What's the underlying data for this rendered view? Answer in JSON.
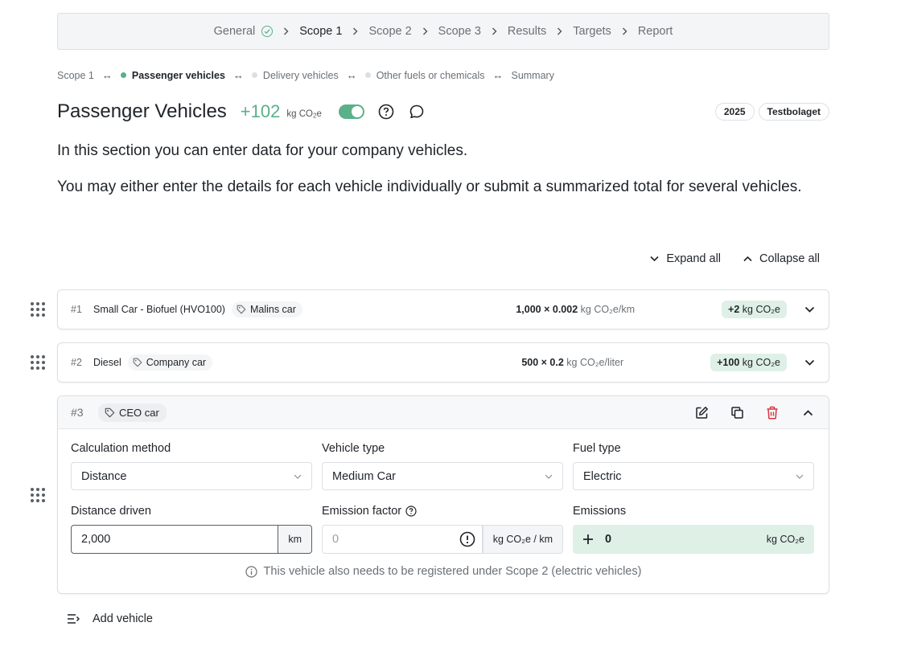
{
  "stepper": {
    "steps": [
      {
        "label": "General",
        "done": true
      },
      {
        "label": "Scope 1",
        "active": true
      },
      {
        "label": "Scope 2"
      },
      {
        "label": "Scope 3"
      },
      {
        "label": "Results"
      },
      {
        "label": "Targets"
      },
      {
        "label": "Report"
      }
    ]
  },
  "subnav": {
    "root": "Scope 1",
    "items": [
      "Passenger vehicles",
      "Delivery vehicles",
      "Other fuels or chemicals",
      "Summary"
    ]
  },
  "header": {
    "title": "Passenger Vehicles",
    "total": "+102",
    "total_unit_prefix": "kg CO",
    "total_unit_sub": "2",
    "total_unit_suffix": "e",
    "year_pill": "2025",
    "company_pill": "Testbolaget"
  },
  "intro": {
    "p1": "In this section you can enter data for your company vehicles.",
    "p2": "You may either enter the details for each vehicle individually or submit a summarized total for several vehicles."
  },
  "controls": {
    "expand_all": "Expand all",
    "collapse_all": "Collapse all"
  },
  "vehicles": [
    {
      "index": "#1",
      "name": "Small Car - Biofuel (HVO100)",
      "tag": "Malins car",
      "formula": "1,000 × 0.002",
      "formula_unit": "kg CO₂e/km",
      "emission": "+2",
      "emission_unit": "kg CO₂e"
    },
    {
      "index": "#2",
      "name": "Diesel",
      "tag": "Company car",
      "formula": "500 × 0.2",
      "formula_unit": "kg CO₂e/liter",
      "emission": "+100",
      "emission_unit": "kg CO₂e"
    }
  ],
  "vehicle3": {
    "index": "#3",
    "tag": "CEO car",
    "calculation_method": {
      "label": "Calculation method",
      "value": "Distance"
    },
    "vehicle_type": {
      "label": "Vehicle type",
      "value": "Medium Car"
    },
    "fuel_type": {
      "label": "Fuel type",
      "value": "Electric"
    },
    "distance": {
      "label": "Distance driven",
      "value": "2,000",
      "unit": "km"
    },
    "emission_factor": {
      "label": "Emission factor",
      "placeholder": "0",
      "unit": "kg CO₂e / km"
    },
    "emissions": {
      "label": "Emissions",
      "value": "0",
      "unit": "kg CO₂e"
    },
    "notice": "This vehicle also needs to be registered under Scope 2 (electric vehicles)"
  },
  "add_vehicle": "Add vehicle",
  "colors": {
    "accent": "#5bb08a",
    "badge_bg": "#dff0e7",
    "delete": "#d9363e"
  }
}
